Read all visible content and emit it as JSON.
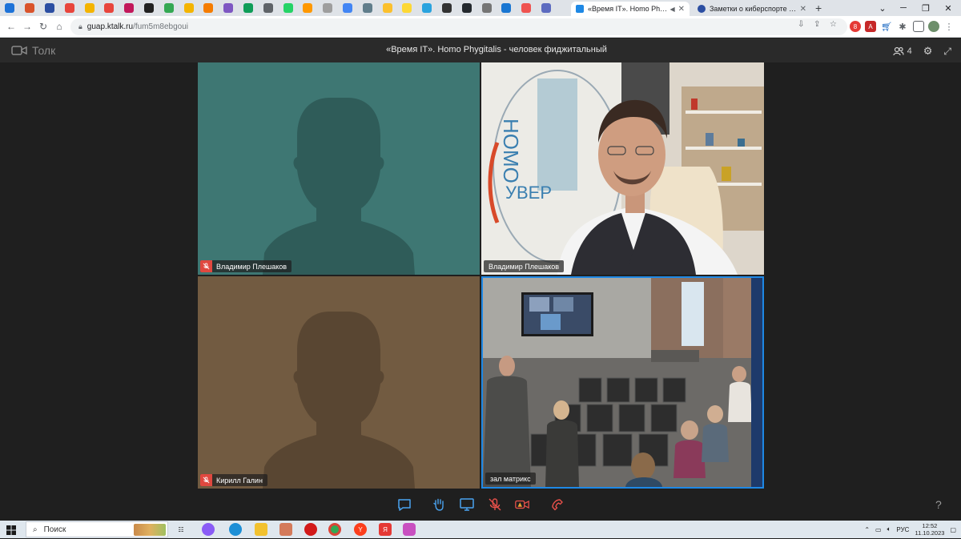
{
  "browser": {
    "pinned_tabs": [
      {
        "icon": "outlook-icon",
        "color": "#1e73d8"
      },
      {
        "icon": "app-icon",
        "color": "#d9542c"
      },
      {
        "icon": "app-icon",
        "color": "#2b4ea2"
      },
      {
        "icon": "app-icon",
        "color": "#e8453c"
      },
      {
        "icon": "app-icon",
        "color": "#f4b400"
      },
      {
        "icon": "app-icon",
        "color": "#e8453c"
      },
      {
        "icon": "app-icon",
        "color": "#c2185b"
      },
      {
        "icon": "app-icon",
        "color": "#222222"
      },
      {
        "icon": "drive-icon",
        "color": "#34a853"
      },
      {
        "icon": "app-icon",
        "color": "#f4b400"
      },
      {
        "icon": "app-icon",
        "color": "#f57c00"
      },
      {
        "icon": "app-icon",
        "color": "#7e57c2"
      },
      {
        "icon": "sheets-icon",
        "color": "#0f9d58"
      },
      {
        "icon": "app-icon",
        "color": "#5f6368"
      },
      {
        "icon": "whatsapp-icon",
        "color": "#25d366"
      },
      {
        "icon": "app-icon",
        "color": "#ff9800"
      },
      {
        "icon": "app-icon",
        "color": "#9e9e9e"
      },
      {
        "icon": "docs-icon",
        "color": "#4285f4"
      },
      {
        "icon": "app-icon",
        "color": "#607d8b"
      },
      {
        "icon": "app-icon",
        "color": "#fbc02d"
      },
      {
        "icon": "app-icon",
        "color": "#fdd835"
      },
      {
        "icon": "telegram-icon",
        "color": "#2aa3de"
      },
      {
        "icon": "app-icon",
        "color": "#333333"
      },
      {
        "icon": "github-icon",
        "color": "#24292e"
      },
      {
        "icon": "app-icon",
        "color": "#757575"
      },
      {
        "icon": "app-icon",
        "color": "#1976d2"
      },
      {
        "icon": "app-icon",
        "color": "#ef5350"
      },
      {
        "icon": "app-icon",
        "color": "#5c6bc0"
      }
    ],
    "active_tab": "«Время IT». Homo Phygital",
    "inactive_tab": "Заметки о киберспорте в РФ: и",
    "new_tab": "+",
    "url_host": "guap.ktalk.ru",
    "url_path": "/fum5m8ebgoui"
  },
  "app": {
    "brand": "Толк",
    "meeting_title": "«Время IT». Homo Phygitalis - человек фиджитальный",
    "participant_count": "4"
  },
  "tiles": [
    {
      "name": "Владимир Плешаков",
      "muted": true,
      "video": false,
      "bg": "#3e7773",
      "fg": "#2f5c59"
    },
    {
      "name": "Владимир Плешаков",
      "muted": false,
      "video": true
    },
    {
      "name": "Кирилл Галин",
      "muted": true,
      "video": false,
      "bg": "#725b41",
      "fg": "#594632"
    },
    {
      "name": "зал матрикс",
      "muted": false,
      "video": true,
      "active_speaker": true
    }
  ],
  "controls": {
    "help": "?"
  },
  "taskbar": {
    "search_label": "Поиск",
    "language": "РУС",
    "time": "12:52",
    "date": "11.10.2023"
  }
}
